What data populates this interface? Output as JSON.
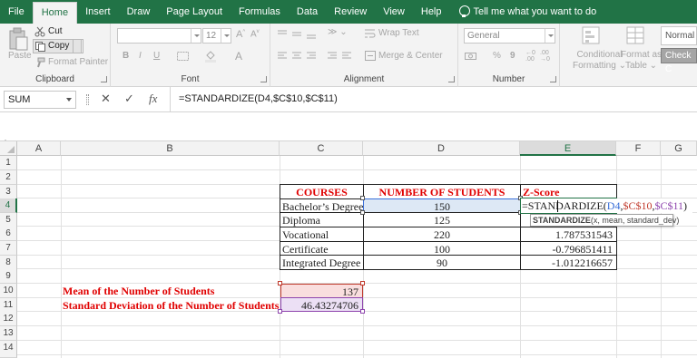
{
  "menu": {
    "tabs": [
      "File",
      "Home",
      "Insert",
      "Draw",
      "Page Layout",
      "Formulas",
      "Data",
      "Review",
      "View",
      "Help"
    ],
    "active": "Home",
    "tell_me": "Tell me what you want to do"
  },
  "ribbon": {
    "clipboard": {
      "paste": "Paste",
      "cut": "Cut",
      "copy": "Copy",
      "format_painter": "Format Painter",
      "label": "Clipboard"
    },
    "font": {
      "size": "12",
      "bold": "B",
      "italic": "I",
      "underline": "U",
      "label": "Font"
    },
    "alignment": {
      "wrap_text": "Wrap Text",
      "merge_center": "Merge & Center",
      "label": "Alignment"
    },
    "number": {
      "format": "General",
      "percent": "%",
      "comma": "9",
      "label": "Number"
    },
    "styles": {
      "conditional": "Conditional Formatting",
      "cond_line1": "Conditional",
      "cond_line2": "Formatting",
      "format_as": "Format as",
      "table": "Table",
      "normal": "Normal",
      "check_cell": "Check C"
    }
  },
  "formula_bar": {
    "name_box": "SUM",
    "cancel": "✕",
    "enter": "✓",
    "fx": "fx",
    "formula": "=STANDARDIZE(D4,$C$10,$C$11)"
  },
  "columns": [
    "A",
    "B",
    "C",
    "D",
    "E",
    "F",
    "G"
  ],
  "rows": [
    "1",
    "2",
    "3",
    "4",
    "5",
    "6",
    "7",
    "8",
    "9",
    "10",
    "11",
    "12",
    "13",
    "14"
  ],
  "table": {
    "headers": {
      "courses": "COURSES",
      "students": "NUMBER OF STUDENTS",
      "zscore": "Z-Score"
    },
    "courses": [
      "Bachelor’s Degree",
      "Diploma",
      "Vocational",
      "Certificate",
      "Integrated Degree"
    ],
    "students": [
      "150",
      "125",
      "220",
      "100",
      "90"
    ],
    "zscores": [
      "",
      "",
      "1.787531543",
      "-0.796851411",
      "-1.012216657"
    ]
  },
  "stats": {
    "mean_label": "Mean of the Number of Students",
    "mean_value": "137",
    "sd_label": "Standard Deviation of the Number of Students",
    "sd_value": "46.43274706"
  },
  "editing": {
    "prefix": "=STANDARDIZE(",
    "arg1": "D4",
    "arg2": "$C$10",
    "arg3": "$C$11",
    "suffix": ")",
    "tooltip_fn": "STANDARDIZE",
    "tooltip_args": "(x, mean, standard_dev)"
  },
  "colors": {
    "excel_green": "#217346",
    "header_red": "#e00000",
    "arg_blue": "#3a6fd8",
    "arg_red": "#c0392b",
    "arg_purple": "#8e44ad"
  }
}
